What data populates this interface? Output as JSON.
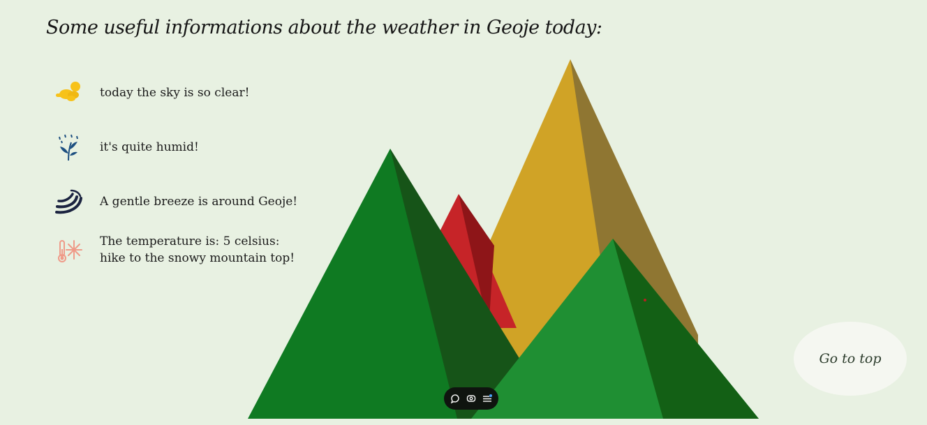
{
  "headline": "Some useful informations about the weather in Geoje today:",
  "weather_items": [
    {
      "icon": "sun-cloud-icon",
      "text": "today the sky is so clear!"
    },
    {
      "icon": "humidity-plant-icon",
      "text": "it's quite humid!"
    },
    {
      "icon": "wind-icon",
      "text": "A gentle breeze is around Geoje!"
    },
    {
      "icon": "cold-thermometer-icon",
      "line1": "The temperature is: 5 celsius:",
      "line2": "hike to the snowy mountain top!"
    }
  ],
  "go_top_label": "Go to top",
  "toolbar": {
    "icons": [
      "comment-icon",
      "eye-icon",
      "menu-icon"
    ]
  },
  "colors": {
    "background": "#e8f1e2",
    "mountain_green_dark": "#0f7a22",
    "mountain_green_light": "#1f8f33",
    "mountain_shadow": "#165418",
    "mountain_gold": "#d0a326",
    "mountain_gold_shadow": "#8f7632",
    "mountain_red": "#c62428",
    "mountain_red_shadow": "#8e1518",
    "sun_icon": "#f7c21a",
    "humidity_icon": "#1d4f80",
    "wind_icon": "#1b2340",
    "cold_icon": "#ef9a88"
  }
}
